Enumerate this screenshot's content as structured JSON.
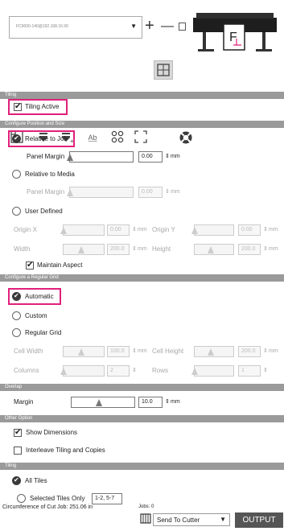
{
  "device": {
    "selector_value": "FC9000-140@192.168.16.90",
    "add_symbol": "+",
    "remove_symbol": "—"
  },
  "sections": {
    "tiling": "Tiling",
    "configure_position": "Configure Position and Size",
    "configure_grid": "Configure a Regular Grid",
    "overlap": "Overlap",
    "other_option": "Other Option",
    "tiling2": "Tiling"
  },
  "tiling_active": {
    "label": "Tiling Active",
    "checked": true
  },
  "position": {
    "relative_to_job": "Relative to Job",
    "panel_margin_label": "Panel Margin",
    "panel_margin_value": "0.00",
    "unit": "mm",
    "relative_to_media": "Relative to Media",
    "panel_margin_label_2": "Panel Margin",
    "panel_margin_value_2": "0.00",
    "user_defined": "User Defined",
    "origin_x_label": "Origin X",
    "origin_x_value": "0.00",
    "origin_y_label": "Origin Y",
    "origin_y_value": "0.00",
    "width_label": "Width",
    "width_value": "200.0",
    "height_label": "Height",
    "height_value": "200.0",
    "maintain_aspect": "Maintain Aspect"
  },
  "grid": {
    "automatic": "Automatic",
    "custom": "Custom",
    "regular_grid": "Regular Grid",
    "cell_width_label": "Cell Width",
    "cell_width_value": "100.0",
    "cell_height_label": "Cell Height",
    "cell_height_value": "200.0",
    "columns_label": "Columns",
    "columns_value": "2",
    "rows_label": "Rows",
    "rows_value": "1"
  },
  "overlap": {
    "margin_label": "Margin",
    "margin_value": "10.0"
  },
  "other": {
    "show_dimensions": "Show Dimensions",
    "interleave": "Interleave Tiling and Copies"
  },
  "tiles": {
    "all_tiles": "All Tiles",
    "selected_tiles_only": "Selected Tiles Only",
    "selected_value": "1-2, 5-7"
  },
  "footer": {
    "circumference": "Circumference of Cut Job: 251.06 in",
    "jobs": "Jobs: 0",
    "send_option": "Send To Cutter",
    "output_button": "OUTPUT"
  },
  "colors": {
    "highlight": "#e0207a",
    "section_bg": "#9a9a9a",
    "output_bg": "#555555"
  },
  "icons": [
    "page-setup-icon",
    "cut-settings-icon",
    "add-cut-icon",
    "text-icon",
    "nodes-icon",
    "frame-icon",
    "tiling-icon",
    "lifebuoy-icon"
  ]
}
